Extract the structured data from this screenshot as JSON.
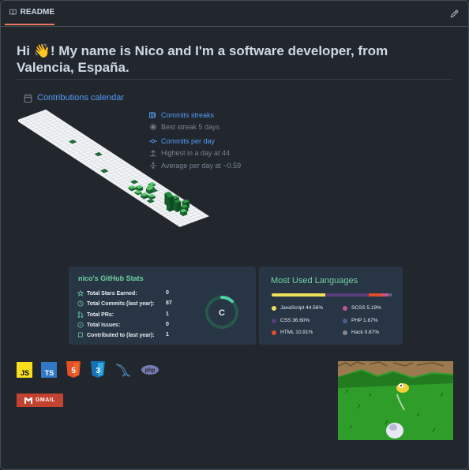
{
  "tab": {
    "label": "README"
  },
  "heading": {
    "pre": "Hi ",
    "emoji": "👋",
    "rest": "! My name is Nico and I'm a software developer, from Valencia, España."
  },
  "calendar": {
    "title": "Contributions calendar"
  },
  "streaks": {
    "commits_streaks": "Commits streaks",
    "best_streak": "Best streak 5 days",
    "commits_per_day": "Commits per day",
    "highest": "Highest in a day at 44",
    "average": "Average per day at ~0.59"
  },
  "gh_stats": {
    "title": "nico's GitHub Stats",
    "rows": [
      {
        "label": "Total Stars Earned:",
        "value": "0"
      },
      {
        "label": "Total Commits (last year):",
        "value": "87"
      },
      {
        "label": "Total PRs:",
        "value": "1"
      },
      {
        "label": "Total Issues:",
        "value": "0"
      },
      {
        "label": "Contributed to (last year):",
        "value": "1"
      }
    ],
    "rank": "C",
    "rank_progress": 0.12,
    "colors": {
      "title": "#70d1a0",
      "ring": "#27584c",
      "ring_fill": "#4fd1a5"
    }
  },
  "languages": {
    "title": "Most Used Languages",
    "items": [
      {
        "name": "JavaScript 44.56%",
        "percent": 44.56,
        "color": "#f1e05a"
      },
      {
        "name": "SCSS 5.19%",
        "percent": 5.19,
        "color": "#c6538c"
      },
      {
        "name": "CSS 36.60%",
        "percent": 36.6,
        "color": "#563d7c"
      },
      {
        "name": "PHP 1.87%",
        "percent": 1.87,
        "color": "#4F5D95"
      },
      {
        "name": "HTML 10.91%",
        "percent": 10.91,
        "color": "#e34c26"
      },
      {
        "name": "Hack 0.87%",
        "percent": 0.87,
        "color": "#878787"
      }
    ]
  },
  "tech_icons": [
    {
      "name": "javascript-icon",
      "text": "JS",
      "bg": "#f7df1e",
      "fg": "#000000"
    },
    {
      "name": "typescript-icon",
      "text": "TS",
      "bg": "#3178c6",
      "fg": "#ffffff"
    },
    {
      "name": "html5-icon",
      "text": "5",
      "bg": "#e34f26",
      "fg": "#ffffff"
    },
    {
      "name": "css3-icon",
      "text": "3",
      "bg": "#1572b6",
      "fg": "#ffffff"
    },
    {
      "name": "mysql-icon"
    },
    {
      "name": "php-icon",
      "text": "php",
      "bg": "#777bb3",
      "fg": "#22272e"
    }
  ],
  "gmail": {
    "label": "GMAIL",
    "color": "#c44230"
  },
  "colors": {
    "accent": "#539bf5",
    "tab_underline": "#ec775c"
  }
}
